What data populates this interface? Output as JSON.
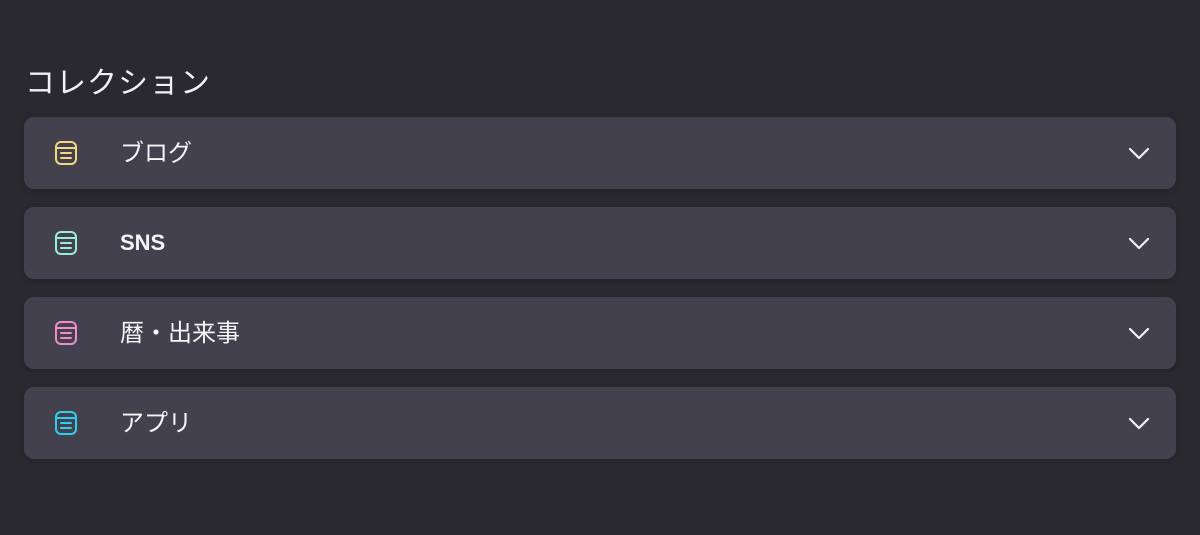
{
  "page": {
    "title": "コレクション"
  },
  "collections": {
    "items": [
      {
        "label": "ブログ",
        "icon": "collection-icon",
        "color": "#f4d77f",
        "latin": false
      },
      {
        "label": "SNS",
        "icon": "collection-icon",
        "color": "#98eed9",
        "latin": true
      },
      {
        "label": "暦・出来事",
        "icon": "collection-icon",
        "color": "#f08bc4",
        "latin": false
      },
      {
        "label": "アプリ",
        "icon": "collection-icon",
        "color": "#2bd0ef",
        "latin": false
      }
    ],
    "expand_icon": "chevron-down-icon"
  }
}
